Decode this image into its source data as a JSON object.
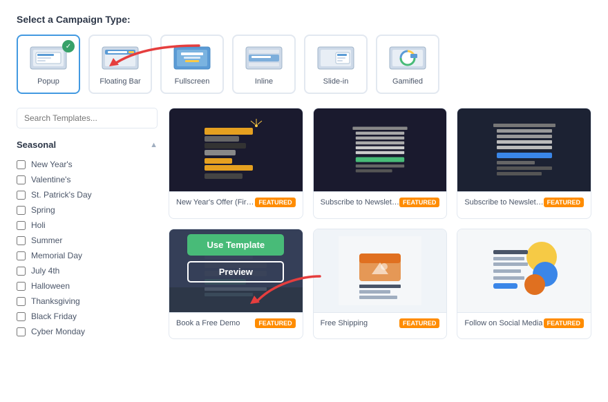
{
  "page": {
    "section_title": "Select a Campaign Type:"
  },
  "campaign_types": [
    {
      "id": "popup",
      "label": "Popup",
      "selected": true
    },
    {
      "id": "floating-bar",
      "label": "Floating Bar",
      "selected": false
    },
    {
      "id": "fullscreen",
      "label": "Fullscreen",
      "selected": false
    },
    {
      "id": "inline",
      "label": "Inline",
      "selected": false
    },
    {
      "id": "slide-in",
      "label": "Slide-in",
      "selected": false
    },
    {
      "id": "gamified",
      "label": "Gamified",
      "selected": false
    }
  ],
  "sidebar": {
    "search_placeholder": "Search Templates...",
    "seasonal_label": "Seasonal",
    "items": [
      {
        "id": "new-years",
        "label": "New Year's",
        "checked": false
      },
      {
        "id": "valentines",
        "label": "Valentine's",
        "checked": false
      },
      {
        "id": "st-patricks",
        "label": "St. Patrick's Day",
        "checked": false
      },
      {
        "id": "spring",
        "label": "Spring",
        "checked": false
      },
      {
        "id": "holi",
        "label": "Holi",
        "checked": false
      },
      {
        "id": "summer",
        "label": "Summer",
        "checked": false
      },
      {
        "id": "memorial-day",
        "label": "Memorial Day",
        "checked": false
      },
      {
        "id": "july-4th",
        "label": "July 4th",
        "checked": false
      },
      {
        "id": "halloween",
        "label": "Halloween",
        "checked": false
      },
      {
        "id": "thanksgiving",
        "label": "Thanksgiving",
        "checked": false
      },
      {
        "id": "black-friday",
        "label": "Black Friday",
        "checked": false
      },
      {
        "id": "cyber-monday",
        "label": "Cyber Monday",
        "checked": false
      }
    ]
  },
  "templates": [
    {
      "id": "newyear",
      "name": "New Year's Offer (Firewo...",
      "featured": true,
      "featured_label": "FEATURED",
      "type": "newyear",
      "show_overlay": false
    },
    {
      "id": "subscribe1",
      "name": "Subscribe to Newsletter ...",
      "featured": true,
      "featured_label": "FEATURED",
      "type": "subscribe1",
      "show_overlay": false
    },
    {
      "id": "subscribe2",
      "name": "Subscribe to Newsletter ...",
      "featured": true,
      "featured_label": "FEATURED",
      "type": "subscribe2",
      "show_overlay": false
    },
    {
      "id": "demo",
      "name": "Book a Free Demo",
      "featured": true,
      "featured_label": "FEATURED",
      "type": "demo",
      "show_overlay": true,
      "btn_use": "Use Template",
      "btn_preview": "Preview"
    },
    {
      "id": "shipping",
      "name": "Free Shipping",
      "featured": true,
      "featured_label": "FEATURED",
      "type": "shipping",
      "show_overlay": false
    },
    {
      "id": "social",
      "name": "Follow on Social Media",
      "featured": true,
      "featured_label": "FEATURED",
      "type": "social",
      "show_overlay": false
    }
  ]
}
